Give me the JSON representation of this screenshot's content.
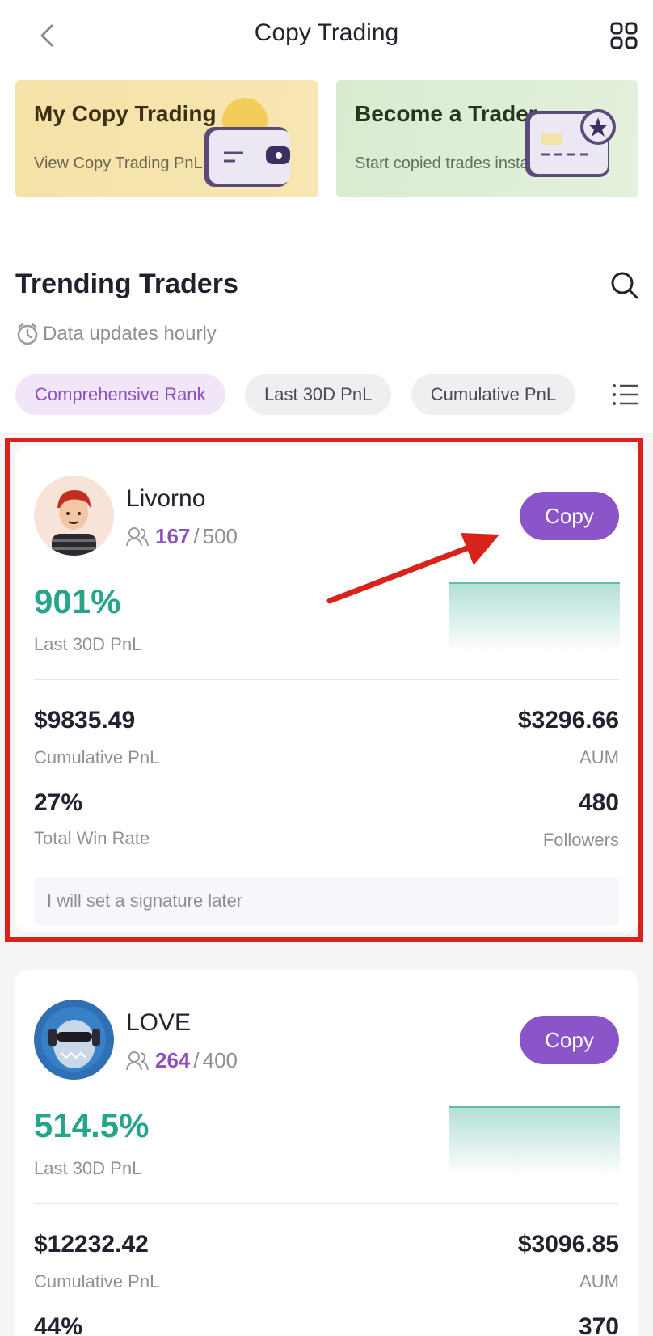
{
  "header": {
    "title": "Copy Trading"
  },
  "banners": {
    "my_copy_trading": {
      "title": "My Copy Trading",
      "subtitle": "View Copy Trading PnL"
    },
    "become_trader": {
      "title": "Become a Trader",
      "subtitle": "Start copied trades insta..."
    }
  },
  "section": {
    "title": "Trending Traders",
    "updates": "Data updates hourly"
  },
  "filters": [
    "Comprehensive Rank",
    "Last 30D PnL",
    "Cumulative PnL"
  ],
  "traders": [
    {
      "name": "Livorno",
      "followers_current": "167",
      "followers_sep": "/",
      "followers_max": "500",
      "copy_label": "Copy",
      "pnl_30d": "901%",
      "pnl_30d_label": "Last 30D PnL",
      "cumulative_pnl": "$9835.49",
      "cumulative_pnl_label": "Cumulative PnL",
      "aum": "$3296.66",
      "aum_label": "AUM",
      "win_rate": "27%",
      "win_rate_label": "Total Win Rate",
      "followers_total": "480",
      "followers_label": "Followers",
      "signature": "I will set a signature later"
    },
    {
      "name": "LOVE",
      "followers_current": "264",
      "followers_sep": "/",
      "followers_max": "400",
      "copy_label": "Copy",
      "pnl_30d": "514.5%",
      "pnl_30d_label": "Last 30D PnL",
      "cumulative_pnl": "$12232.42",
      "cumulative_pnl_label": "Cumulative PnL",
      "aum": "$3096.85",
      "aum_label": "AUM",
      "win_rate": "44%",
      "followers_total": "370"
    }
  ],
  "colors": {
    "accent_purple": "#8c54c9",
    "pnl_green": "#27a58b",
    "annotation_red": "#d8231c"
  },
  "icons": [
    "back-icon",
    "grid-menu-icon",
    "search-icon",
    "clock-icon",
    "list-filter-icon",
    "followers-icon"
  ]
}
